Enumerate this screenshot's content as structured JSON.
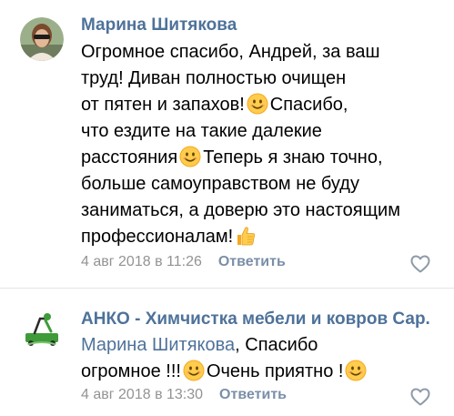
{
  "comments": [
    {
      "author": "Марина Шитякова",
      "lines": {
        "l1": "Огромное спасибо, Андрей, за ваш",
        "l2": "труд! Диван полностью очищен",
        "l3a": "от пятен и запахов!",
        "l3b": "Спасибо,",
        "l4": "что ездите на такие далекие",
        "l5a": "расстояния",
        "l5b": "Теперь я знаю точно,",
        "l6": "больше самоуправством не буду",
        "l7": "заниматься, а доверю это настоящим",
        "l8": "профессионалам!"
      },
      "date": "4 авг 2018 в 11:26",
      "reply_label": "Ответить"
    },
    {
      "author": "АНКО - Химчистка мебели и ковров Сар...",
      "mention": "Марина Шитякова",
      "lines": {
        "l1": ", Спасибо",
        "l2a": "огромное !!!",
        "l2b": "Очень приятно !"
      },
      "date": "4 авг 2018 в 13:30",
      "reply_label": "Ответить"
    }
  ],
  "colors": {
    "author": "#4e729a",
    "meta": "#939393",
    "reply": "#7a8fa8",
    "divider": "#e3e4e8"
  },
  "icons": {
    "emoji": "smiling-face-emoji",
    "thumb": "thumbs-up-emoji",
    "like": "heart-outline-icon"
  }
}
